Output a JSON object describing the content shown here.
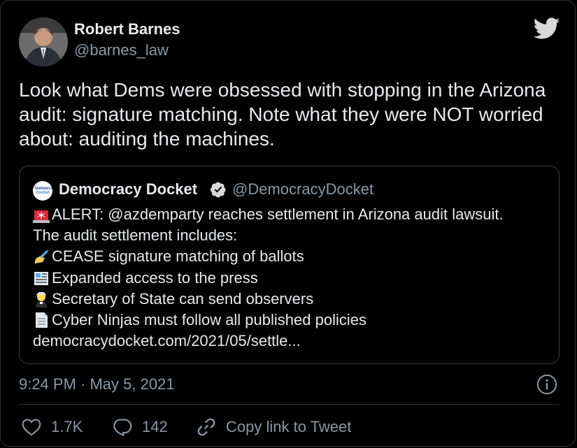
{
  "author": {
    "name": "Robert Barnes",
    "handle": "@barnes_law"
  },
  "tweet": {
    "text": "Look what Dems were obsessed with stopping in the Arizona audit: signature matching. Note what they were NOT worried about: auditing the machines.",
    "timestamp": "9:24 PM · May 5, 2021"
  },
  "quote": {
    "avatar_text_line1": "Democracy",
    "avatar_text_line2": "Docket",
    "name": "Democracy Docket",
    "handle": "@DemocracyDocket",
    "lines": [
      {
        "emoji": "police-light-icon",
        "text": "ALERT: @azdemparty reaches settlement in Arizona audit lawsuit."
      },
      {
        "emoji": "",
        "text": "The audit settlement includes:"
      },
      {
        "emoji": "writing-hand-icon",
        "text": "CEASE signature matching of ballots"
      },
      {
        "emoji": "newspaper-icon",
        "text": "Expanded access to the press"
      },
      {
        "emoji": "judge-icon",
        "text": "Secretary of State can send observers"
      },
      {
        "emoji": "document-icon",
        "text": "Cyber Ninjas must follow all published policies"
      },
      {
        "emoji": "",
        "text": "democracydocket.com/2021/05/settle..."
      }
    ]
  },
  "actions": {
    "likes": "1.7K",
    "replies": "142",
    "copy_link": "Copy link to Tweet"
  },
  "colors": {
    "background": "#000000",
    "text": "#e7e9ea",
    "secondary": "#8b98a5",
    "twitter_blue": "#1d9bf0",
    "border": "#2f3336"
  }
}
